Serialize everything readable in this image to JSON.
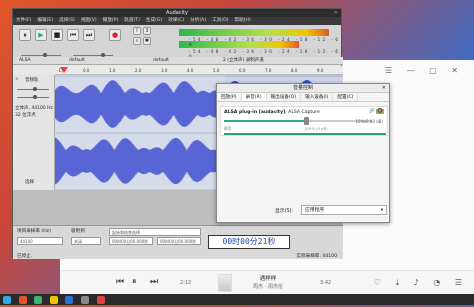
{
  "audacity": {
    "title": "Audacity",
    "menu": [
      "文件(F)",
      "编辑(E)",
      "选择(S)",
      "视图(V)",
      "播放(P)",
      "轨道(T)",
      "生成(G)",
      "效果(C)",
      "分析(A)",
      "工具(O)",
      "帮助(H)"
    ],
    "meter_scale": "-54 -48 -42 -36 -30 -24 -18 -12 -6 0",
    "device_host": "ALSA",
    "device_default": "default",
    "channels": "2 (立体声) 录制声道",
    "ruler": [
      "-1.0",
      "0.0",
      "1.0",
      "2.0",
      "3.0",
      "4.0",
      "5.0",
      "6.0",
      "7.0",
      "8.0",
      "9.0"
    ],
    "track": {
      "close": "×",
      "name": "音频轨",
      "info": [
        "立体声, 44100 Hz",
        "32 位浮点"
      ],
      "sel_label": "选择"
    },
    "selection": {
      "rate_label": "项目采样率 (Hz)",
      "snap_label": "吸附到",
      "rate_value": "44100",
      "snap_value": "关闭",
      "start_label": "起始和结束选择",
      "start_time": "00时00分00.000秒",
      "end_time": "00时00分00.000秒",
      "big_time": "00时00分21秒"
    },
    "status_left": "已停止.",
    "status_right": "实际采样率: 44100"
  },
  "volume_control": {
    "title": "音量控制",
    "tabs": [
      "回放(P)",
      "录音(R)",
      "输出设备(O)",
      "输入设备(I)",
      "配置(C)"
    ],
    "active_tab": 1,
    "stream_name": "ALSA plug-in [audacity]: ALSA Capture",
    "stream_name_bold": "ALSA plug-in [audacity]",
    "stream_name_rest": ": ALSA Capture",
    "lr_button": "🔗",
    "mute_icon": "🔇",
    "volume_pct": "15%(0.00 dB)",
    "volume_fraction": 0.15,
    "scale_labels": [
      "静音",
      "100% (0 dB)"
    ],
    "show_label": "显示(S):",
    "show_value": "应用程序"
  },
  "player": {
    "song": "遇样样",
    "artist": "周杰 - 周杰伦",
    "lyric": "...",
    "time_current": "2:12",
    "time_total": "3:42"
  },
  "colors": {
    "wave": "#3344cc",
    "meter_green": "#2fb84e",
    "timebox_text": "#2244aa"
  }
}
